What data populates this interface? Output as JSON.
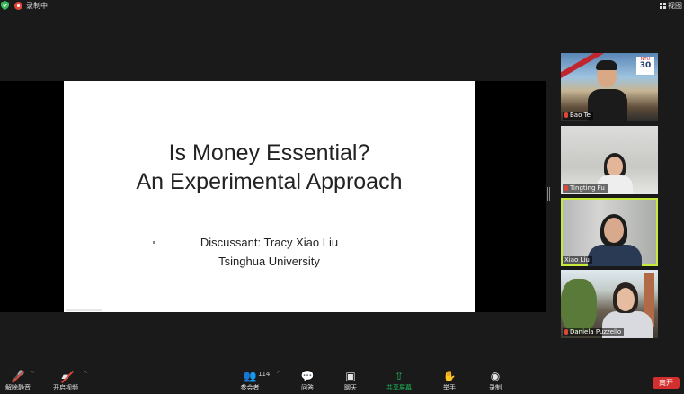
{
  "topbar": {
    "recording_label": "录制中",
    "view_label": "视图",
    "colors": {
      "shield": "#3bb85b",
      "record": "#e0473b"
    }
  },
  "slide": {
    "title_line1": "Is Money Essential?",
    "title_line2": "An Experimental Approach",
    "discussant": "Discussant: Tracy Xiao Liu",
    "affiliation": "Tsinghua University"
  },
  "participants": [
    {
      "name": "Bao Te",
      "muted": true,
      "logo": "NTU",
      "logo_number": "30"
    },
    {
      "name": "Tingting Fu",
      "muted": true
    },
    {
      "name": "Xiao Liu",
      "muted": false,
      "active": true
    },
    {
      "name": "Daniela Puzzello",
      "muted": true
    }
  ],
  "toolbar": {
    "unmute": {
      "label": "解除静音",
      "icon": "mic-muted-icon"
    },
    "start_video": {
      "label": "开启视频",
      "icon": "video-off-icon"
    },
    "participants": {
      "label": "参会者",
      "icon": "people-icon",
      "count": "114"
    },
    "qa": {
      "label": "问答",
      "icon": "qa-icon"
    },
    "chat": {
      "label": "聊天",
      "icon": "chat-icon"
    },
    "share_screen": {
      "label": "共享屏幕",
      "icon": "share-icon",
      "color": "#1bb757"
    },
    "raise_hand": {
      "label": "举手",
      "icon": "hand-icon"
    },
    "record": {
      "label": "录制",
      "icon": "record-icon"
    },
    "leave": {
      "label": "离开",
      "color": "#d32f2f"
    }
  }
}
